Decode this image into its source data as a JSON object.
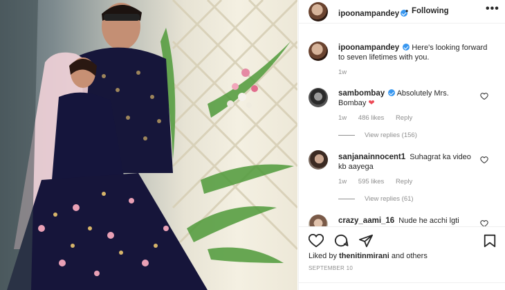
{
  "header": {
    "username": "ipoonampandey",
    "separator": "•",
    "follow_label": "Following",
    "more_label": "•••"
  },
  "caption": {
    "username": "ipoonampandey",
    "text": "Here's looking forward to seven lifetimes with you.",
    "time": "1w"
  },
  "comments": [
    {
      "username": "sambombay",
      "verified": true,
      "text": "Absolutely Mrs. Bombay",
      "emoji": "❤",
      "time": "1w",
      "likes": "486 likes",
      "reply_label": "Reply",
      "view_replies": "View replies (156)"
    },
    {
      "username": "sanjanainnocent1",
      "text": "Suhagrat ka video kb aayega",
      "time": "1w",
      "likes": "595 likes",
      "reply_label": "Reply",
      "view_replies": "View replies (61)"
    },
    {
      "username": "crazy_aami_16",
      "text": "Nude he acchi lgti"
    }
  ],
  "actions": {
    "icons": [
      "heart-icon",
      "comment-icon",
      "share-icon",
      "bookmark-icon"
    ],
    "liked_by_prefix": "Liked by",
    "liked_by_user": "thenitinmirani",
    "liked_by_suffix": "and others",
    "date": "SEPTEMBER 10"
  },
  "colors": {
    "verified": "#3897f0",
    "heart_red": "#ed4956",
    "muted_text": "#8e8e8e"
  }
}
